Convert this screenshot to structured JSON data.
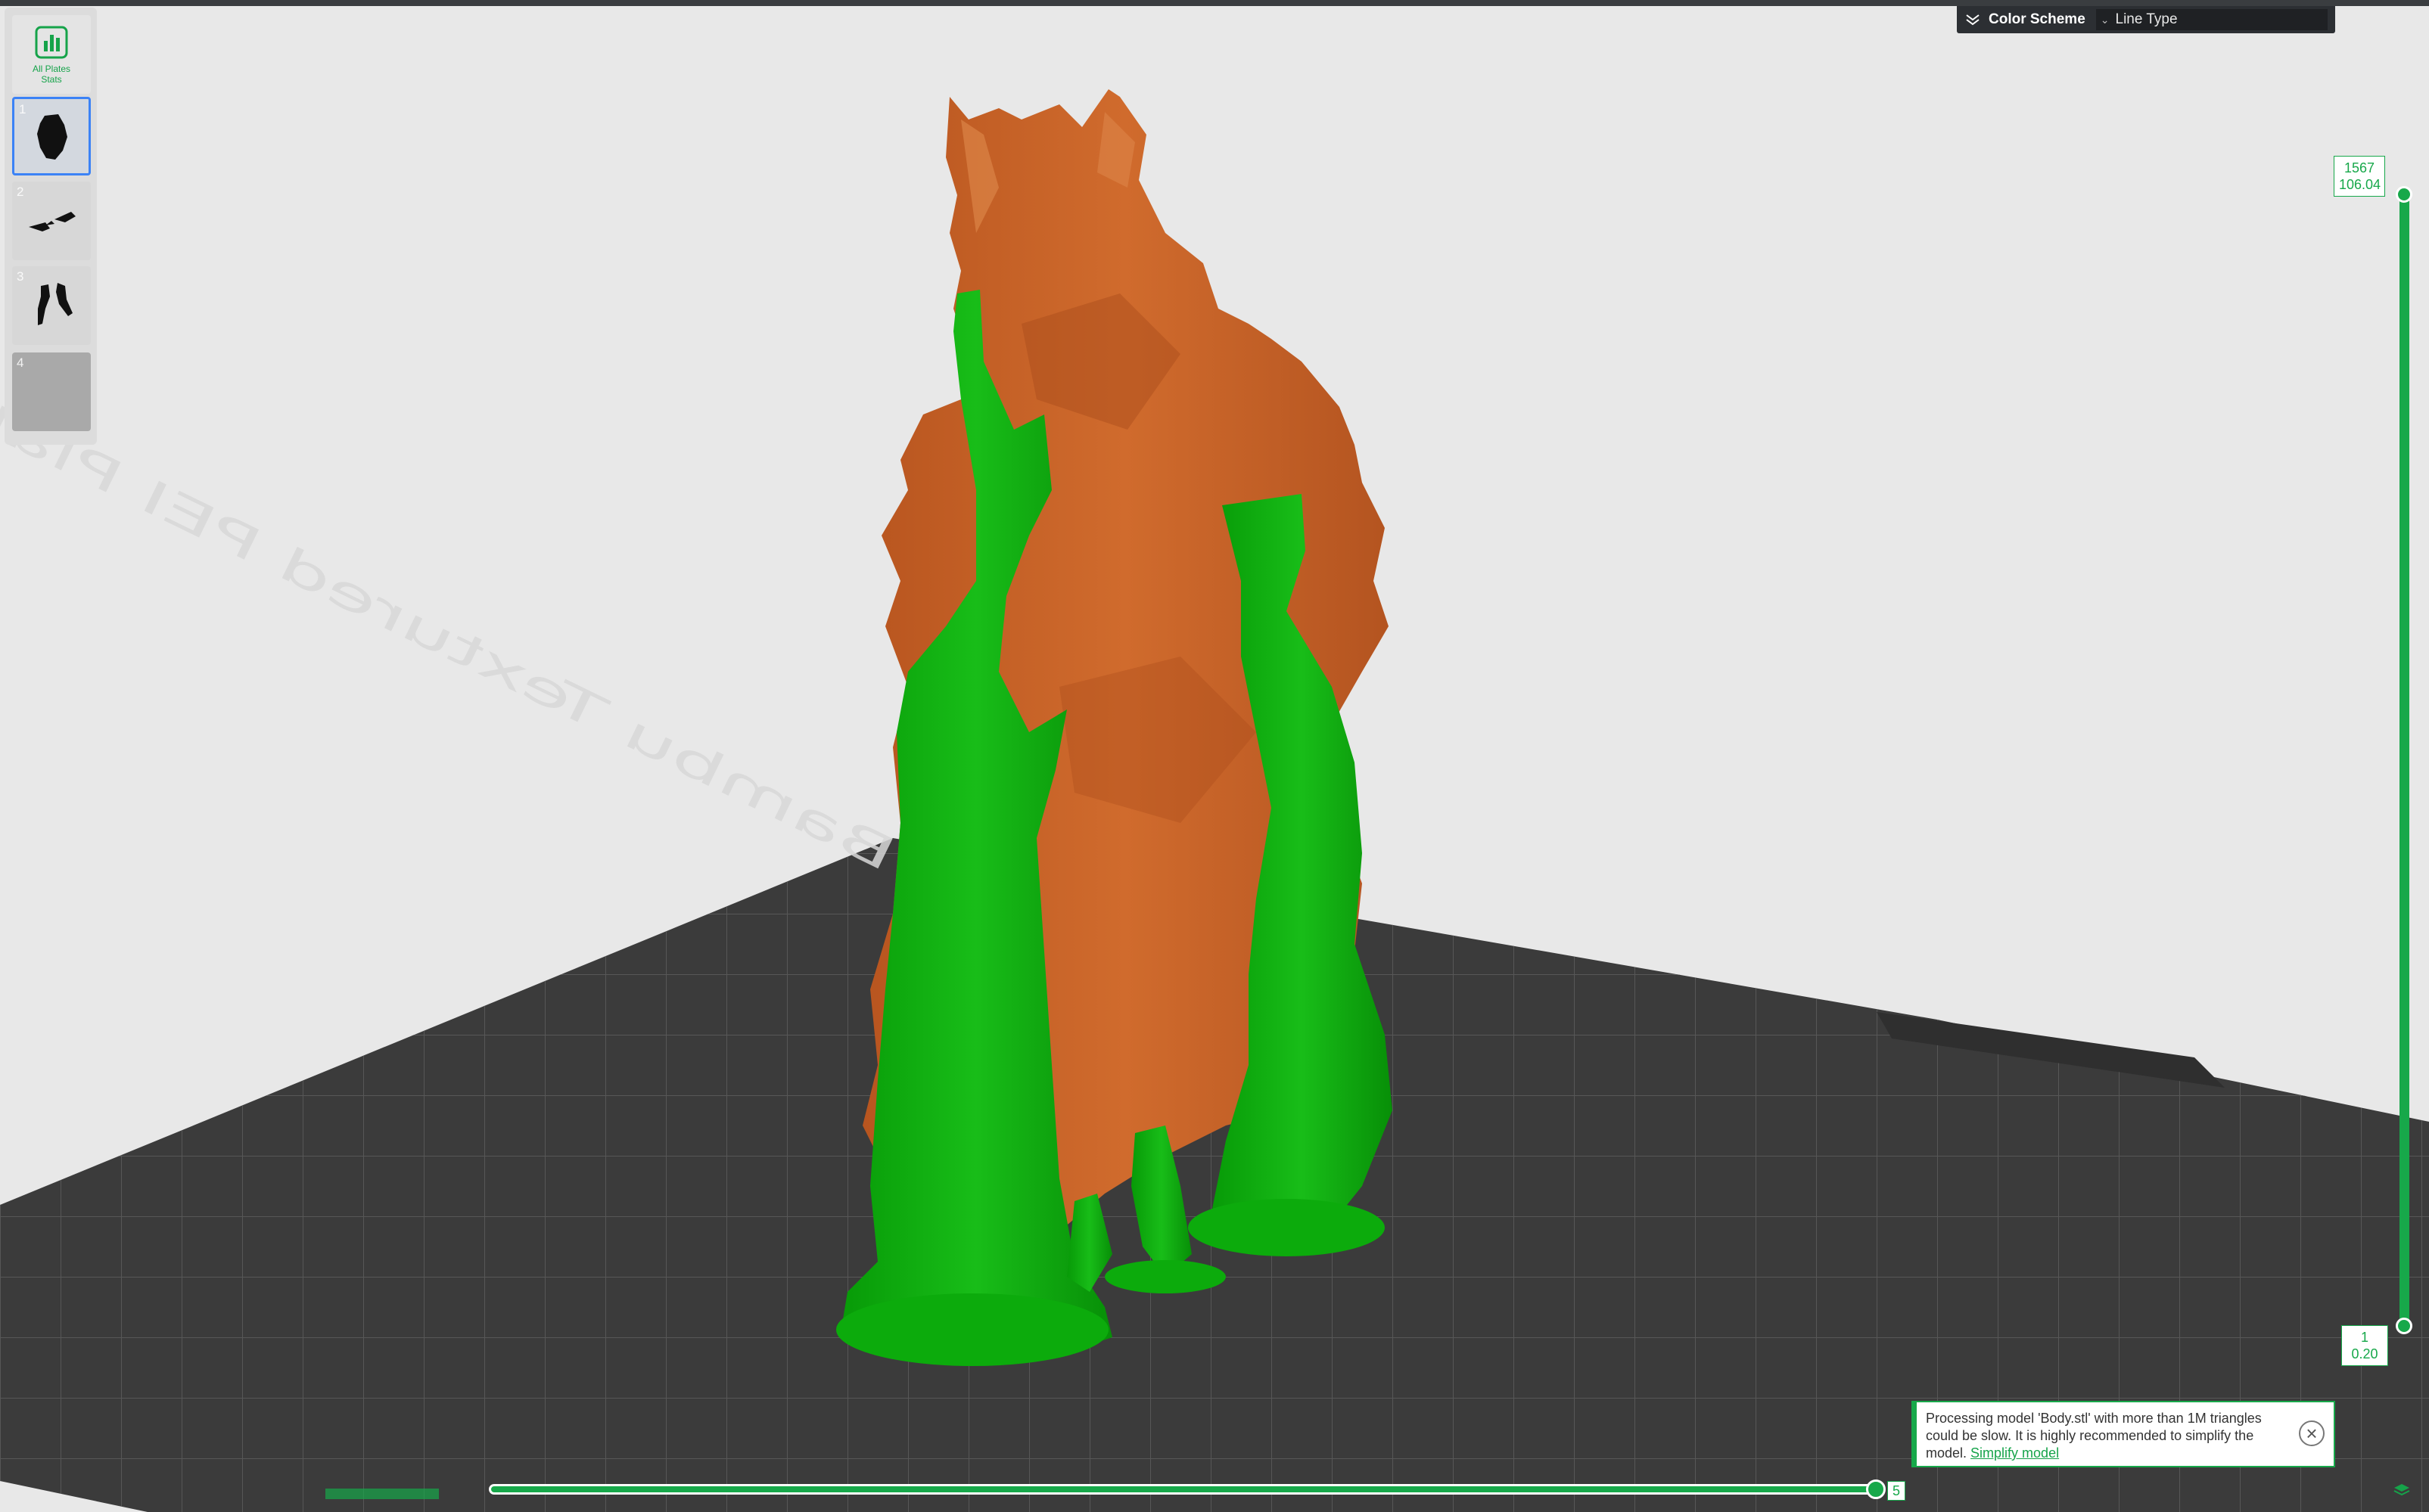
{
  "sidebar": {
    "stats_label": "All Plates\nStats",
    "plates": [
      {
        "index": "1",
        "selected": true
      },
      {
        "index": "2",
        "selected": false
      },
      {
        "index": "3",
        "selected": false
      },
      {
        "index": "4",
        "selected": false
      }
    ]
  },
  "color_scheme": {
    "title": "Color Scheme",
    "selected": "Line Type"
  },
  "layer_slider": {
    "top_layer": "1567",
    "top_height": "106.04",
    "bottom_layer": "1",
    "bottom_height": "0.20"
  },
  "move_slider": {
    "value": "5"
  },
  "plate_label": "Bambu Textured PEI Plate",
  "notification": {
    "message": "Processing model 'Body.stl' with more than 1M triangles could be slow. It is highly recommended to simplify the model.",
    "link": "Simplify model"
  },
  "colors": {
    "accent": "#17a84a",
    "model": "#c9642a",
    "support": "#0aa80a",
    "bed": "#3b3b3b"
  }
}
